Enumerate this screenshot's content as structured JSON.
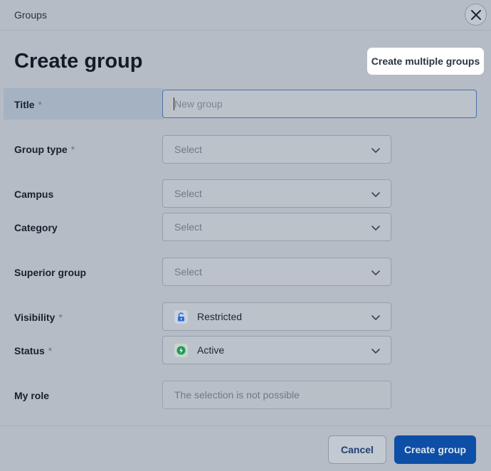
{
  "header": {
    "title": "Groups"
  },
  "page": {
    "title": "Create group"
  },
  "actions": {
    "create_multiple_label": "Create multiple groups",
    "cancel_label": "Cancel",
    "create_label": "Create group"
  },
  "form": {
    "required_marker": "*",
    "title": {
      "label": "Title",
      "placeholder": "New group"
    },
    "group_type": {
      "label": "Group type",
      "value": "Select"
    },
    "campus": {
      "label": "Campus",
      "value": "Select"
    },
    "category": {
      "label": "Category",
      "value": "Select"
    },
    "superior_group": {
      "label": "Superior group",
      "value": "Select"
    },
    "visibility": {
      "label": "Visibility",
      "value": "Restricted",
      "icon": "lock-open-icon",
      "icon_color": "#2f6fd0"
    },
    "status": {
      "label": "Status",
      "value": "Active",
      "icon": "bolt-icon",
      "icon_color": "#1e9a55"
    },
    "my_role": {
      "label": "My role",
      "value": "The selection is not possible"
    }
  },
  "colors": {
    "primary": "#0d4ea6",
    "cancel_text": "#1f3f73"
  }
}
